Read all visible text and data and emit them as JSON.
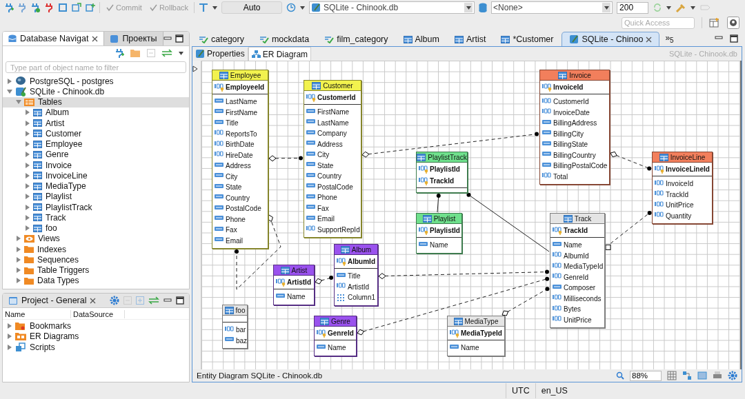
{
  "toolbar": {
    "buttons": [
      {
        "label": "Commit",
        "disabled": true
      },
      {
        "label": "Rollback",
        "disabled": true
      }
    ],
    "transaction_mode": "Auto",
    "datasource": "SQLite - Chinook.db",
    "schema": "<None>",
    "fetch_size": "200",
    "quick_access": {
      "placeholder": "Quick Access"
    }
  },
  "navigator": {
    "tabs": [
      {
        "label": "Database Navigat",
        "selected": true,
        "closable": true
      },
      {
        "label": "Проекты",
        "selected": false,
        "closable": false
      }
    ],
    "filter": {
      "placeholder": "Type part of object name to filter"
    },
    "tree": [
      {
        "label": "PostgreSQL - postgres",
        "kind": "postgres",
        "expanded": false,
        "selected": false
      },
      {
        "label": "SQLite - Chinook.db",
        "kind": "sqlite",
        "expanded": true,
        "selected": false,
        "children": [
          {
            "label": "Tables",
            "kind": "tables",
            "expanded": true,
            "selected": true,
            "children": [
              {
                "label": "Album",
                "kind": "table",
                "expanded": false,
                "selected": false
              },
              {
                "label": "Artist",
                "kind": "table",
                "expanded": false,
                "selected": false
              },
              {
                "label": "Customer",
                "kind": "table",
                "expanded": false,
                "selected": false
              },
              {
                "label": "Employee",
                "kind": "table",
                "expanded": false,
                "selected": false
              },
              {
                "label": "Genre",
                "kind": "table",
                "expanded": false,
                "selected": false
              },
              {
                "label": "Invoice",
                "kind": "table",
                "expanded": false,
                "selected": false
              },
              {
                "label": "InvoiceLine",
                "kind": "table",
                "expanded": false,
                "selected": false
              },
              {
                "label": "MediaType",
                "kind": "table",
                "expanded": false,
                "selected": false
              },
              {
                "label": "Playlist",
                "kind": "table",
                "expanded": false,
                "selected": false
              },
              {
                "label": "PlaylistTrack",
                "kind": "table",
                "expanded": false,
                "selected": false
              },
              {
                "label": "Track",
                "kind": "table",
                "expanded": false,
                "selected": false
              },
              {
                "label": "foo",
                "kind": "table",
                "expanded": false,
                "selected": false
              }
            ]
          },
          {
            "label": "Views",
            "kind": "views",
            "expanded": false,
            "selected": false
          },
          {
            "label": "Indexes",
            "kind": "folder",
            "expanded": false,
            "selected": false
          },
          {
            "label": "Sequences",
            "kind": "folder",
            "expanded": false,
            "selected": false
          },
          {
            "label": "Table Triggers",
            "kind": "folder",
            "expanded": false,
            "selected": false
          },
          {
            "label": "Data Types",
            "kind": "folder",
            "expanded": false,
            "selected": false
          }
        ]
      }
    ]
  },
  "project": {
    "title": "Project - General",
    "columns": [
      "Name",
      "DataSource"
    ],
    "items": [
      {
        "label": "Bookmarks",
        "kind": "bookmarks",
        "expanded": false
      },
      {
        "label": "ER Diagrams",
        "kind": "diagrams",
        "expanded": false
      },
      {
        "label": "Scripts",
        "kind": "scripts",
        "expanded": false
      }
    ]
  },
  "editor": {
    "tabs": [
      {
        "label": "category",
        "kind": "script",
        "selected": false,
        "closable": false
      },
      {
        "label": "mockdata",
        "kind": "script",
        "selected": false,
        "closable": false
      },
      {
        "label": "film_category",
        "kind": "script",
        "selected": false,
        "closable": false
      },
      {
        "label": "Album",
        "kind": "table",
        "selected": false,
        "closable": false
      },
      {
        "label": "Artist",
        "kind": "table",
        "selected": false,
        "closable": false
      },
      {
        "label": "*Customer",
        "kind": "table",
        "selected": false,
        "closable": false
      },
      {
        "label": "SQLite - Chinoo",
        "kind": "diagram",
        "selected": true,
        "closable": true
      }
    ],
    "overflow": "»$_{5}$",
    "subtabs": [
      {
        "label": "Properties",
        "selected": false
      },
      {
        "label": "ER Diagram",
        "selected": true
      }
    ],
    "object": "SQLite - Chinook.db"
  },
  "diagram": {
    "entities": [
      {
        "name": "Employee",
        "color": "#f2f24e",
        "columns": [
          {
            "name": "EmployeeId",
            "kind": "number",
            "primary": true
          },
          {
            "name": "LastName",
            "kind": "text",
            "primary": false
          },
          {
            "name": "FirstName",
            "kind": "text",
            "primary": false
          },
          {
            "name": "Title",
            "kind": "text",
            "primary": false
          },
          {
            "name": "ReportsTo",
            "kind": "number",
            "primary": false
          },
          {
            "name": "BirthDate",
            "kind": "number",
            "primary": false
          },
          {
            "name": "HireDate",
            "kind": "number",
            "primary": false
          },
          {
            "name": "Address",
            "kind": "text",
            "primary": false
          },
          {
            "name": "City",
            "kind": "text",
            "primary": false
          },
          {
            "name": "State",
            "kind": "text",
            "primary": false
          },
          {
            "name": "Country",
            "kind": "text",
            "primary": false
          },
          {
            "name": "PostalCode",
            "kind": "text",
            "primary": false
          },
          {
            "name": "Phone",
            "kind": "text",
            "primary": false
          },
          {
            "name": "Fax",
            "kind": "text",
            "primary": false
          },
          {
            "name": "Email",
            "kind": "text",
            "primary": false
          }
        ]
      },
      {
        "name": "Customer",
        "color": "#f2f24e",
        "columns": [
          {
            "name": "CustomerId",
            "kind": "number",
            "primary": true
          },
          {
            "name": "FirstName",
            "kind": "text",
            "primary": false
          },
          {
            "name": "LastName",
            "kind": "text",
            "primary": false
          },
          {
            "name": "Company",
            "kind": "text",
            "primary": false
          },
          {
            "name": "Address",
            "kind": "text",
            "primary": false
          },
          {
            "name": "City",
            "kind": "text",
            "primary": false
          },
          {
            "name": "State",
            "kind": "text",
            "primary": false
          },
          {
            "name": "Country",
            "kind": "text",
            "primary": false
          },
          {
            "name": "PostalCode",
            "kind": "text",
            "primary": false
          },
          {
            "name": "Phone",
            "kind": "text",
            "primary": false
          },
          {
            "name": "Fax",
            "kind": "text",
            "primary": false
          },
          {
            "name": "Email",
            "kind": "text",
            "primary": false
          },
          {
            "name": "SupportRepId",
            "kind": "number",
            "primary": false
          }
        ]
      },
      {
        "name": "Invoice",
        "color": "#f27f5c",
        "columns": [
          {
            "name": "InvoiceId",
            "kind": "number",
            "primary": true
          },
          {
            "name": "CustomerId",
            "kind": "number",
            "primary": false
          },
          {
            "name": "InvoiceDate",
            "kind": "number",
            "primary": false
          },
          {
            "name": "BillingAddress",
            "kind": "text",
            "primary": false
          },
          {
            "name": "BillingCity",
            "kind": "text",
            "primary": false
          },
          {
            "name": "BillingState",
            "kind": "text",
            "primary": false
          },
          {
            "name": "BillingCountry",
            "kind": "text",
            "primary": false
          },
          {
            "name": "BillingPostalCode",
            "kind": "text",
            "primary": false
          },
          {
            "name": "Total",
            "kind": "number",
            "primary": false
          }
        ]
      },
      {
        "name": "PlaylistTrack",
        "color": "#6fe08c",
        "columns": [
          {
            "name": "PlaylistId",
            "kind": "number",
            "primary": true
          },
          {
            "name": "TrackId",
            "kind": "number",
            "primary": true
          }
        ]
      },
      {
        "name": "Playlist",
        "color": "#6fe08c",
        "columns": [
          {
            "name": "PlaylistId",
            "kind": "number",
            "primary": true
          },
          {
            "name": "Name",
            "kind": "text",
            "primary": false
          }
        ]
      },
      {
        "name": "InvoiceLine",
        "color": "#f27f5c",
        "columns": [
          {
            "name": "InvoiceLineId",
            "kind": "number",
            "primary": true
          },
          {
            "name": "InvoiceId",
            "kind": "number",
            "primary": false
          },
          {
            "name": "TrackId",
            "kind": "number",
            "primary": false
          },
          {
            "name": "UnitPrice",
            "kind": "number",
            "primary": false
          },
          {
            "name": "Quantity",
            "kind": "number",
            "primary": false
          }
        ]
      },
      {
        "name": "Track",
        "color": "#e4e4e4",
        "columns": [
          {
            "name": "TrackId",
            "kind": "number",
            "primary": true
          },
          {
            "name": "Name",
            "kind": "text",
            "primary": false
          },
          {
            "name": "AlbumId",
            "kind": "number",
            "primary": false
          },
          {
            "name": "MediaTypeId",
            "kind": "number",
            "primary": false
          },
          {
            "name": "GenreId",
            "kind": "number",
            "primary": false
          },
          {
            "name": "Composer",
            "kind": "text",
            "primary": false
          },
          {
            "name": "Milliseconds",
            "kind": "number",
            "primary": false
          },
          {
            "name": "Bytes",
            "kind": "number",
            "primary": false
          },
          {
            "name": "UnitPrice",
            "kind": "number",
            "primary": false
          }
        ]
      },
      {
        "name": "Artist",
        "color": "#9a52ee",
        "columns": [
          {
            "name": "ArtistId",
            "kind": "number",
            "primary": true
          },
          {
            "name": "Name",
            "kind": "text",
            "primary": false
          }
        ]
      },
      {
        "name": "Album",
        "color": "#9a52ee",
        "columns": [
          {
            "name": "AlbumId",
            "kind": "number",
            "primary": true
          },
          {
            "name": "Title",
            "kind": "text",
            "primary": false
          },
          {
            "name": "ArtistId",
            "kind": "number",
            "primary": false
          },
          {
            "name": "Column1",
            "kind": "binary",
            "primary": false
          }
        ]
      },
      {
        "name": "foo",
        "color": "#e4e4e4",
        "columns": [
          {
            "name": "bar",
            "kind": "number",
            "primary": false
          },
          {
            "name": "baz",
            "kind": "text",
            "primary": false
          }
        ]
      },
      {
        "name": "Genre",
        "color": "#9a52ee",
        "columns": [
          {
            "name": "GenreId",
            "kind": "number",
            "primary": true
          },
          {
            "name": "Name",
            "kind": "text",
            "primary": false
          }
        ]
      },
      {
        "name": "MediaType",
        "color": "#e4e4e4",
        "columns": [
          {
            "name": "MediaTypeId",
            "kind": "number",
            "primary": true
          },
          {
            "name": "Name",
            "kind": "text",
            "primary": false
          }
        ]
      }
    ],
    "footer": "Entity Diagram SQLite - Chinook.db",
    "zoom": "88%"
  },
  "status_bar": [
    "UTC",
    "en_US"
  ]
}
